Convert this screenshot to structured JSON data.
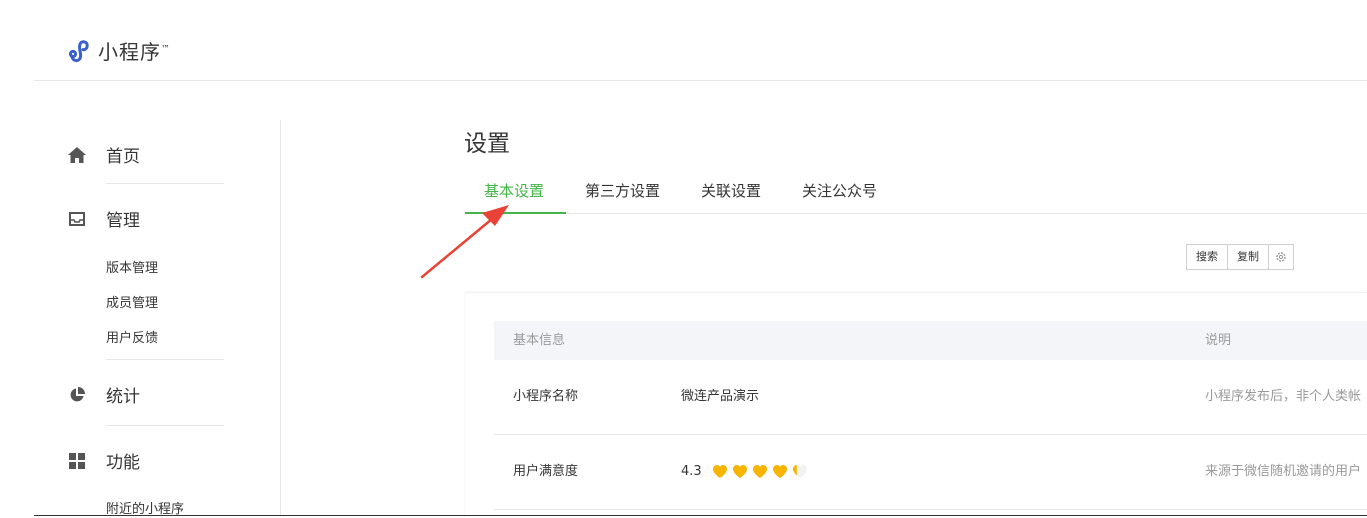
{
  "header": {
    "app_name": "小程序",
    "tm": "™"
  },
  "sidebar": {
    "sections": [
      {
        "label": "首页",
        "icon": "home-icon"
      },
      {
        "label": "管理",
        "icon": "inbox-icon",
        "items": [
          "版本管理",
          "成员管理",
          "用户反馈"
        ]
      },
      {
        "label": "统计",
        "icon": "pie-chart-icon"
      },
      {
        "label": "功能",
        "icon": "grid-icon",
        "items": [
          "附近的小程序"
        ]
      }
    ]
  },
  "main": {
    "title": "设置",
    "tabs": [
      {
        "label": "基本设置",
        "active": true
      },
      {
        "label": "第三方设置",
        "active": false
      },
      {
        "label": "关联设置",
        "active": false
      },
      {
        "label": "关注公众号",
        "active": false
      }
    ],
    "toolbar": {
      "search_label": "搜索",
      "copy_label": "复制",
      "gear_icon": "gear-icon"
    },
    "table": {
      "headers": [
        "基本信息",
        "说明"
      ],
      "rows": [
        {
          "name": "小程序名称",
          "value": "微连产品演示",
          "desc": "小程序发布后，非个人类帐"
        },
        {
          "name": "用户满意度",
          "value": "4.3",
          "rating": 4.3,
          "rating_max": 5,
          "desc": "来源于微信随机邀请的用户"
        }
      ]
    }
  },
  "colors": {
    "accent": "#44b549",
    "arrow": "#e84336",
    "heart": "#f7b500",
    "logo": "#3b60c9"
  }
}
